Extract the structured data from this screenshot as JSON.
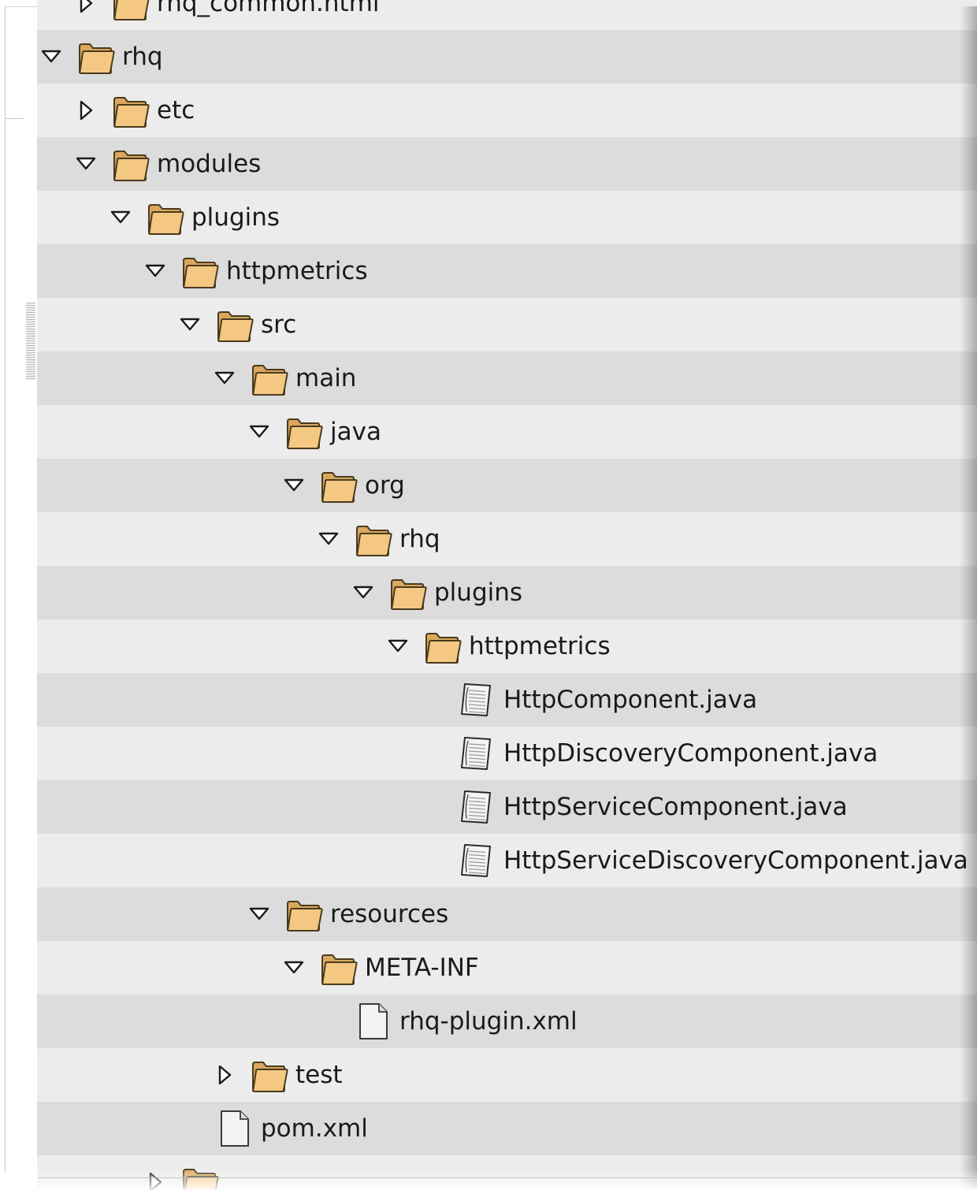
{
  "tree": {
    "rows": [
      {
        "label": "rhq_common.html",
        "kind": "folder",
        "state": "collapsed",
        "depth": 1,
        "partial": "top"
      },
      {
        "label": "rhq",
        "kind": "folder",
        "state": "expanded",
        "depth": 0
      },
      {
        "label": "etc",
        "kind": "folder",
        "state": "collapsed",
        "depth": 1
      },
      {
        "label": "modules",
        "kind": "folder",
        "state": "expanded",
        "depth": 1
      },
      {
        "label": "plugins",
        "kind": "folder",
        "state": "expanded",
        "depth": 2
      },
      {
        "label": "httpmetrics",
        "kind": "folder",
        "state": "expanded",
        "depth": 3
      },
      {
        "label": "src",
        "kind": "folder",
        "state": "expanded",
        "depth": 4
      },
      {
        "label": "main",
        "kind": "folder",
        "state": "expanded",
        "depth": 5
      },
      {
        "label": "java",
        "kind": "folder",
        "state": "expanded",
        "depth": 6
      },
      {
        "label": "org",
        "kind": "folder",
        "state": "expanded",
        "depth": 7
      },
      {
        "label": "rhq",
        "kind": "folder",
        "state": "expanded",
        "depth": 8
      },
      {
        "label": "plugins",
        "kind": "folder",
        "state": "expanded",
        "depth": 9
      },
      {
        "label": "httpmetrics",
        "kind": "folder",
        "state": "expanded",
        "depth": 10
      },
      {
        "label": "HttpComponent.java",
        "kind": "java-file",
        "state": "leaf",
        "depth": 11
      },
      {
        "label": "HttpDiscoveryComponent.java",
        "kind": "java-file",
        "state": "leaf",
        "depth": 11
      },
      {
        "label": "HttpServiceComponent.java",
        "kind": "java-file",
        "state": "leaf",
        "depth": 11
      },
      {
        "label": "HttpServiceDiscoveryComponent.java",
        "kind": "java-file",
        "state": "leaf",
        "depth": 11
      },
      {
        "label": "resources",
        "kind": "folder",
        "state": "expanded",
        "depth": 6
      },
      {
        "label": "META-INF",
        "kind": "folder",
        "state": "expanded",
        "depth": 7
      },
      {
        "label": "rhq-plugin.xml",
        "kind": "file",
        "state": "leaf",
        "depth": 8
      },
      {
        "label": "test",
        "kind": "folder",
        "state": "collapsed",
        "depth": 5
      },
      {
        "label": "pom.xml",
        "kind": "file",
        "state": "leaf",
        "depth": 4
      },
      {
        "label": "",
        "kind": "folder",
        "state": "collapsed",
        "depth": 3,
        "partial": "bottom"
      }
    ]
  },
  "colors": {
    "row_dark": "#dcdcdc",
    "row_light": "#ececec",
    "folder_fill": "#f4c882",
    "folder_stroke": "#4a3a1e",
    "text": "#1a1a1a"
  },
  "icons": {
    "folder": "folder-icon",
    "java-file": "java-file-icon",
    "file": "file-icon",
    "expanded": "triangle-down-icon",
    "collapsed": "triangle-right-icon"
  }
}
